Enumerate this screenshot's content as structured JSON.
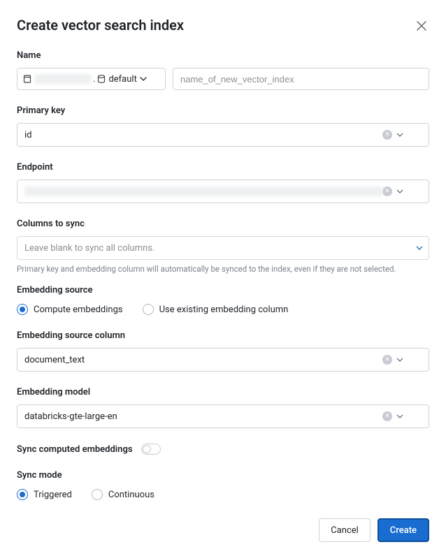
{
  "header": {
    "title": "Create vector search index"
  },
  "name": {
    "label": "Name",
    "schema": "default",
    "input_placeholder": "name_of_new_vector_index"
  },
  "primary_key": {
    "label": "Primary key",
    "value": "id"
  },
  "endpoint": {
    "label": "Endpoint"
  },
  "columns": {
    "label": "Columns to sync",
    "placeholder": "Leave blank to sync all columns.",
    "helper": "Primary key and embedding column will automatically be synced to the index, even if they are not selected."
  },
  "embedding_source": {
    "label": "Embedding source",
    "options": {
      "compute": "Compute embeddings",
      "existing": "Use existing embedding column"
    },
    "selected": "compute"
  },
  "source_column": {
    "label": "Embedding source column",
    "value": "document_text"
  },
  "model": {
    "label": "Embedding model",
    "value": "databricks-gte-large-en"
  },
  "sync_computed": {
    "label": "Sync computed embeddings",
    "value": false
  },
  "sync_mode": {
    "label": "Sync mode",
    "options": {
      "triggered": "Triggered",
      "continuous": "Continuous"
    },
    "selected": "triggered"
  },
  "footer": {
    "cancel": "Cancel",
    "create": "Create"
  }
}
